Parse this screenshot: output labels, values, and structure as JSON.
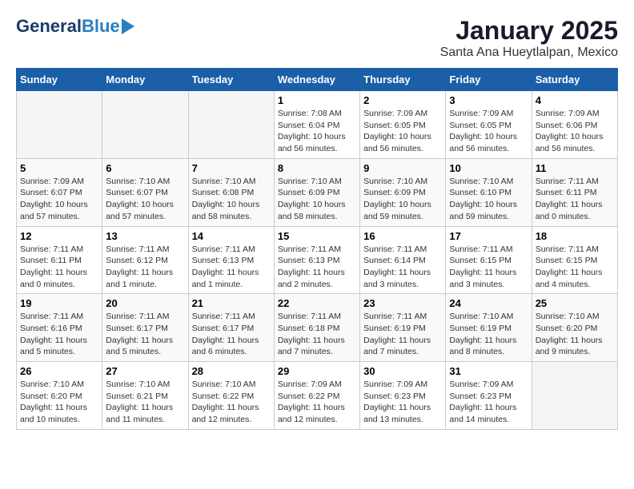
{
  "logo": {
    "general": "General",
    "blue": "Blue"
  },
  "title": "January 2025",
  "subtitle": "Santa Ana Hueytlalpan, Mexico",
  "headers": [
    "Sunday",
    "Monday",
    "Tuesday",
    "Wednesday",
    "Thursday",
    "Friday",
    "Saturday"
  ],
  "weeks": [
    [
      {
        "day": "",
        "info": ""
      },
      {
        "day": "",
        "info": ""
      },
      {
        "day": "",
        "info": ""
      },
      {
        "day": "1",
        "info": "Sunrise: 7:08 AM\nSunset: 6:04 PM\nDaylight: 10 hours\nand 56 minutes."
      },
      {
        "day": "2",
        "info": "Sunrise: 7:09 AM\nSunset: 6:05 PM\nDaylight: 10 hours\nand 56 minutes."
      },
      {
        "day": "3",
        "info": "Sunrise: 7:09 AM\nSunset: 6:05 PM\nDaylight: 10 hours\nand 56 minutes."
      },
      {
        "day": "4",
        "info": "Sunrise: 7:09 AM\nSunset: 6:06 PM\nDaylight: 10 hours\nand 56 minutes."
      }
    ],
    [
      {
        "day": "5",
        "info": "Sunrise: 7:09 AM\nSunset: 6:07 PM\nDaylight: 10 hours\nand 57 minutes."
      },
      {
        "day": "6",
        "info": "Sunrise: 7:10 AM\nSunset: 6:07 PM\nDaylight: 10 hours\nand 57 minutes."
      },
      {
        "day": "7",
        "info": "Sunrise: 7:10 AM\nSunset: 6:08 PM\nDaylight: 10 hours\nand 58 minutes."
      },
      {
        "day": "8",
        "info": "Sunrise: 7:10 AM\nSunset: 6:09 PM\nDaylight: 10 hours\nand 58 minutes."
      },
      {
        "day": "9",
        "info": "Sunrise: 7:10 AM\nSunset: 6:09 PM\nDaylight: 10 hours\nand 59 minutes."
      },
      {
        "day": "10",
        "info": "Sunrise: 7:10 AM\nSunset: 6:10 PM\nDaylight: 10 hours\nand 59 minutes."
      },
      {
        "day": "11",
        "info": "Sunrise: 7:11 AM\nSunset: 6:11 PM\nDaylight: 11 hours\nand 0 minutes."
      }
    ],
    [
      {
        "day": "12",
        "info": "Sunrise: 7:11 AM\nSunset: 6:11 PM\nDaylight: 11 hours\nand 0 minutes."
      },
      {
        "day": "13",
        "info": "Sunrise: 7:11 AM\nSunset: 6:12 PM\nDaylight: 11 hours\nand 1 minute."
      },
      {
        "day": "14",
        "info": "Sunrise: 7:11 AM\nSunset: 6:13 PM\nDaylight: 11 hours\nand 1 minute."
      },
      {
        "day": "15",
        "info": "Sunrise: 7:11 AM\nSunset: 6:13 PM\nDaylight: 11 hours\nand 2 minutes."
      },
      {
        "day": "16",
        "info": "Sunrise: 7:11 AM\nSunset: 6:14 PM\nDaylight: 11 hours\nand 3 minutes."
      },
      {
        "day": "17",
        "info": "Sunrise: 7:11 AM\nSunset: 6:15 PM\nDaylight: 11 hours\nand 3 minutes."
      },
      {
        "day": "18",
        "info": "Sunrise: 7:11 AM\nSunset: 6:15 PM\nDaylight: 11 hours\nand 4 minutes."
      }
    ],
    [
      {
        "day": "19",
        "info": "Sunrise: 7:11 AM\nSunset: 6:16 PM\nDaylight: 11 hours\nand 5 minutes."
      },
      {
        "day": "20",
        "info": "Sunrise: 7:11 AM\nSunset: 6:17 PM\nDaylight: 11 hours\nand 5 minutes."
      },
      {
        "day": "21",
        "info": "Sunrise: 7:11 AM\nSunset: 6:17 PM\nDaylight: 11 hours\nand 6 minutes."
      },
      {
        "day": "22",
        "info": "Sunrise: 7:11 AM\nSunset: 6:18 PM\nDaylight: 11 hours\nand 7 minutes."
      },
      {
        "day": "23",
        "info": "Sunrise: 7:11 AM\nSunset: 6:19 PM\nDaylight: 11 hours\nand 7 minutes."
      },
      {
        "day": "24",
        "info": "Sunrise: 7:10 AM\nSunset: 6:19 PM\nDaylight: 11 hours\nand 8 minutes."
      },
      {
        "day": "25",
        "info": "Sunrise: 7:10 AM\nSunset: 6:20 PM\nDaylight: 11 hours\nand 9 minutes."
      }
    ],
    [
      {
        "day": "26",
        "info": "Sunrise: 7:10 AM\nSunset: 6:20 PM\nDaylight: 11 hours\nand 10 minutes."
      },
      {
        "day": "27",
        "info": "Sunrise: 7:10 AM\nSunset: 6:21 PM\nDaylight: 11 hours\nand 11 minutes."
      },
      {
        "day": "28",
        "info": "Sunrise: 7:10 AM\nSunset: 6:22 PM\nDaylight: 11 hours\nand 12 minutes."
      },
      {
        "day": "29",
        "info": "Sunrise: 7:09 AM\nSunset: 6:22 PM\nDaylight: 11 hours\nand 12 minutes."
      },
      {
        "day": "30",
        "info": "Sunrise: 7:09 AM\nSunset: 6:23 PM\nDaylight: 11 hours\nand 13 minutes."
      },
      {
        "day": "31",
        "info": "Sunrise: 7:09 AM\nSunset: 6:23 PM\nDaylight: 11 hours\nand 14 minutes."
      },
      {
        "day": "",
        "info": ""
      }
    ]
  ]
}
